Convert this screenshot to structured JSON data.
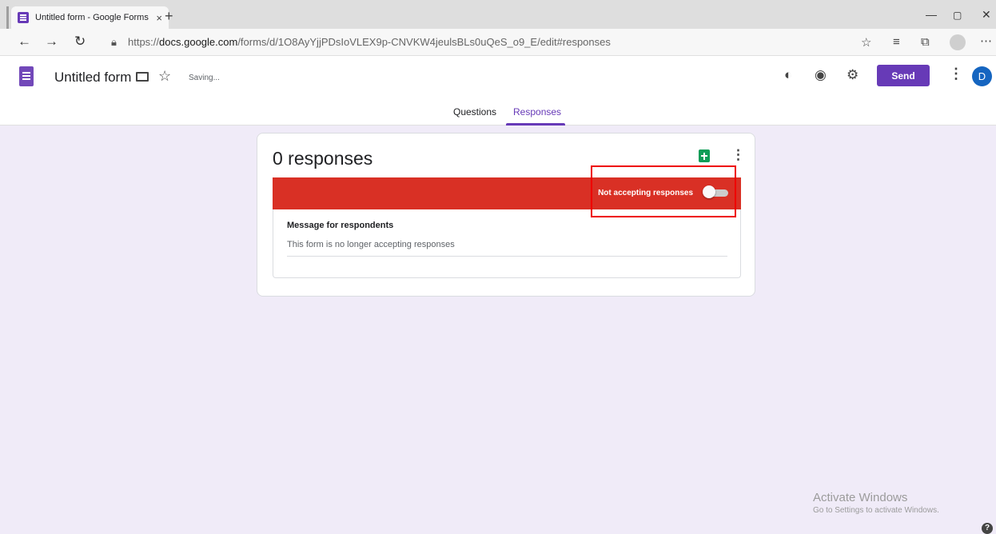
{
  "browser": {
    "tab_title": "Untitled form - Google Forms",
    "tab_close": "×",
    "new_tab": "+",
    "url_prefix": "https://",
    "url_domain": "docs.google.com",
    "url_path": "/forms/d/1O8AyYjjPDsIoVLEX9p-CNVKW4jeulsBLs0uQeS_o9_E/edit#responses",
    "icons": [
      "back-icon",
      "forward-icon",
      "refresh-icon",
      "lock-icon",
      "favorite-star-icon",
      "favorites-icon",
      "collections-icon",
      "profile-icon",
      "more-icon"
    ]
  },
  "forms_header": {
    "title": "Untitled form",
    "status": "Saving...",
    "send_label": "Send",
    "avatar_letter": "D",
    "tabs": [
      {
        "label": "Questions",
        "active": false
      },
      {
        "label": "Responses",
        "active": true
      }
    ],
    "accent_color": "#673ab7"
  },
  "responses": {
    "count_label": "0 responses",
    "status_bar_label": "Not accepting responses",
    "status_bar_color": "#d93025",
    "accepting_toggle_on": false,
    "message_label": "Message for respondents",
    "message_value": "This form is no longer accepting responses"
  },
  "watermark": {
    "title": "Activate Windows",
    "subtitle": "Go to Settings to activate Windows."
  },
  "help_label": "?"
}
